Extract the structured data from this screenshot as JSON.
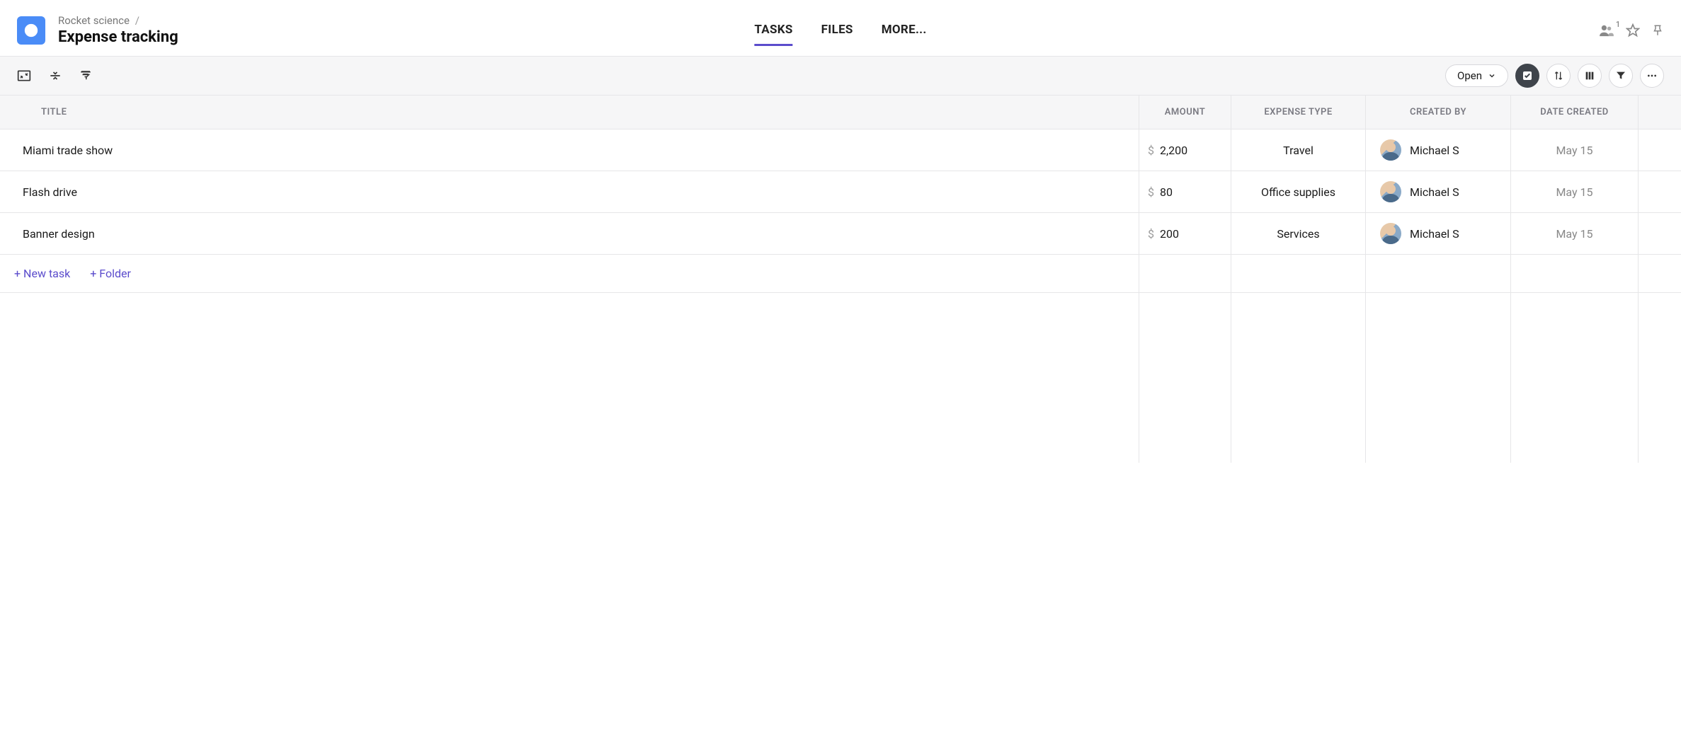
{
  "breadcrumb": {
    "parent": "Rocket science",
    "sep": "/"
  },
  "page_title": "Expense tracking",
  "nav": {
    "tasks": "TASKS",
    "files": "FILES",
    "more": "MORE..."
  },
  "header_actions": {
    "people_count": "1"
  },
  "toolbar": {
    "filter_status": "Open"
  },
  "columns": {
    "title": "TITLE",
    "amount": "AMOUNT",
    "expense_type": "EXPENSE TYPE",
    "created_by": "CREATED BY",
    "date_created": "DATE CREATED"
  },
  "currency_symbol": "$",
  "rows": [
    {
      "title": "Miami trade show",
      "amount": "2,200",
      "expense_type": "Travel",
      "created_by": "Michael S",
      "date_created": "May 15"
    },
    {
      "title": "Flash drive",
      "amount": "80",
      "expense_type": "Office supplies",
      "created_by": "Michael S",
      "date_created": "May 15"
    },
    {
      "title": "Banner design",
      "amount": "200",
      "expense_type": "Services",
      "created_by": "Michael S",
      "date_created": "May 15"
    }
  ],
  "add": {
    "new_task": "+ New task",
    "new_folder": "+ Folder"
  }
}
